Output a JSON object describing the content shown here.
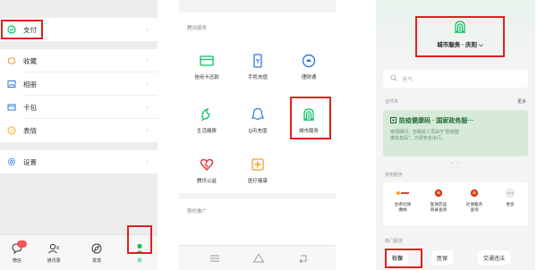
{
  "panel1": {
    "menu": [
      {
        "label": "支付",
        "icon": "pay-icon"
      },
      {
        "label": "收藏",
        "icon": "favorites-icon"
      },
      {
        "label": "相册",
        "icon": "album-icon"
      },
      {
        "label": "卡包",
        "icon": "card-wallet-icon"
      },
      {
        "label": "表情",
        "icon": "stickers-icon"
      },
      {
        "label": "设置",
        "icon": "settings-icon"
      }
    ],
    "tabs": [
      {
        "label": "微信",
        "badge": "···"
      },
      {
        "label": "通讯录"
      },
      {
        "label": "发现"
      },
      {
        "label": "我"
      }
    ]
  },
  "panel2": {
    "section_title": "腾讯服务",
    "services": [
      {
        "label": "信用卡还款",
        "icon": "credit-card-icon"
      },
      {
        "label": "手机充值",
        "icon": "phone-topup-icon"
      },
      {
        "label": "理财通",
        "icon": "wealth-icon"
      },
      {
        "label": "生活缴费",
        "icon": "utility-icon"
      },
      {
        "label": "Q币充值",
        "icon": "qcoin-icon"
      },
      {
        "label": "城市服务",
        "icon": "city-service-icon"
      },
      {
        "label": "腾讯公益",
        "icon": "charity-icon"
      },
      {
        "label": "医疗健康",
        "icon": "medical-icon"
      }
    ],
    "promo_title": "限时推广"
  },
  "panel3": {
    "city_title": "城市服务 · 庆阳 ⌵",
    "search_placeholder": "天气",
    "cert_label": "证件夹",
    "more_label": "更多",
    "cert_title": "防疫健康码 · 国家政务服···",
    "cert_desc_line1": "疫情期间，自相关人员由于\"防疫健",
    "cert_desc_line2": "康信息码\"，方便安全出行。",
    "common_label": "常用服务",
    "common": [
      {
        "line1": "甘肃社保",
        "line2": "缴纳"
      },
      {
        "line1": "医保药品",
        "line2": "目录查询"
      },
      {
        "line1": "社保服务",
        "line2": "查询"
      },
      {
        "line1": "更多",
        "line2": ""
      }
    ],
    "hot_label": "热门服务",
    "hot": [
      "社保",
      "医保",
      "交通违法"
    ]
  },
  "colors": {
    "accent": "#07c160",
    "highlight": "#e02020"
  }
}
